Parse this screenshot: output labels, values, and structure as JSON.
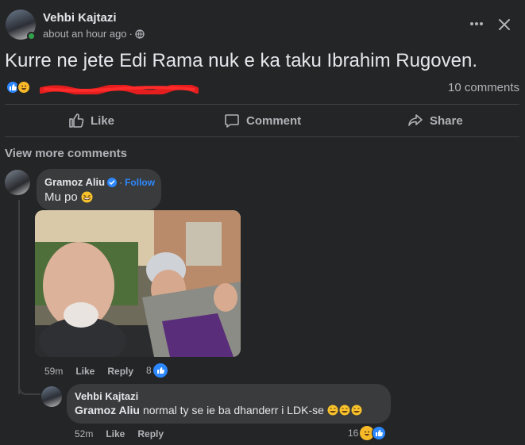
{
  "post": {
    "author": "Vehbi Kajtazi",
    "timestamp": "about an hour ago",
    "privacy_dot": "·",
    "text": "Kurre ne jete Edi Rama nuk e ka taku Ibrahim Rugoven.",
    "comments_count": "10 comments",
    "actions": {
      "like": "Like",
      "comment": "Comment",
      "share": "Share"
    }
  },
  "view_more": "View more comments",
  "comments": [
    {
      "author": "Gramoz Aliu",
      "follow": "Follow",
      "separator": "·",
      "text": "Mu po",
      "time": "59m",
      "like": "Like",
      "reply": "Reply",
      "reactions": "8"
    },
    {
      "author": "Vehbi Kajtazi",
      "mention": "Gramoz Aliu",
      "text": "normal ty se ie ba dhanderr i LDK-se",
      "time": "52m",
      "like": "Like",
      "reply": "Reply",
      "reactions": "16"
    }
  ],
  "icons": {
    "more": "more-icon",
    "close": "close-icon",
    "globe": "globe-icon",
    "like": "thumbs-up-icon",
    "comment": "comment-icon",
    "share": "share-icon",
    "verified": "verified-badge-icon"
  },
  "colors": {
    "background": "#242526",
    "bubble": "#3a3b3c",
    "accent": "#2d88ff",
    "redact": "#e41e1e"
  }
}
